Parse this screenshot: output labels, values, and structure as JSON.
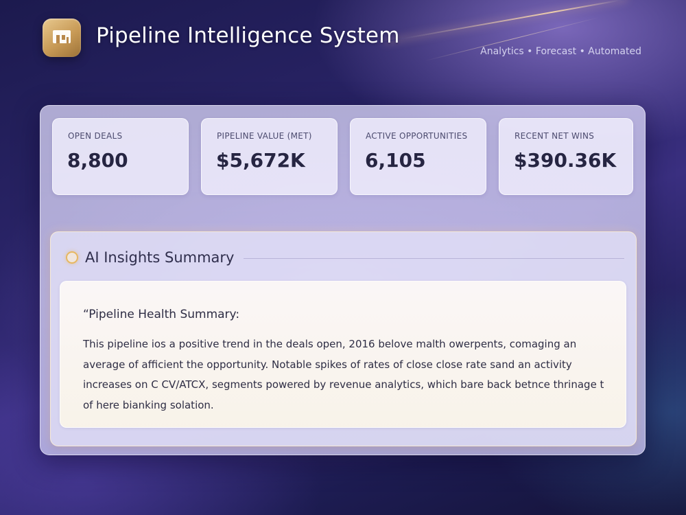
{
  "header": {
    "title": "Pipeline Intelligence System",
    "tagline": "Analytics • Forecast • Automated",
    "logo_icon": "building-icon",
    "logo_color": "#c89a56"
  },
  "stats": [
    {
      "label": "OPEN DEALS",
      "value": "8,800"
    },
    {
      "label": "PIPELINE VALUE (MET)",
      "value": "$5,672K"
    },
    {
      "label": "ACTIVE OPPORTUNITIES",
      "value": "6,105"
    },
    {
      "label": "RECENT NET WINS",
      "value": "$390.36K"
    }
  ],
  "insights": {
    "title": "AI Insights Summary",
    "icon": "circle-indicator-icon",
    "accent_color": "#e7b760",
    "heading": "“Pipeline Health Summary:",
    "body": "This pipeline ios a positive trend in the deals open, 2016 belove malth owerpents, comaging an average of afficient the opportunity. Notable spikes of rates of close close rate sand an activity increases on C CV/ATCX, segments powered by revenue analytics, which bare back betnce thrinage t of here bianking solation."
  }
}
